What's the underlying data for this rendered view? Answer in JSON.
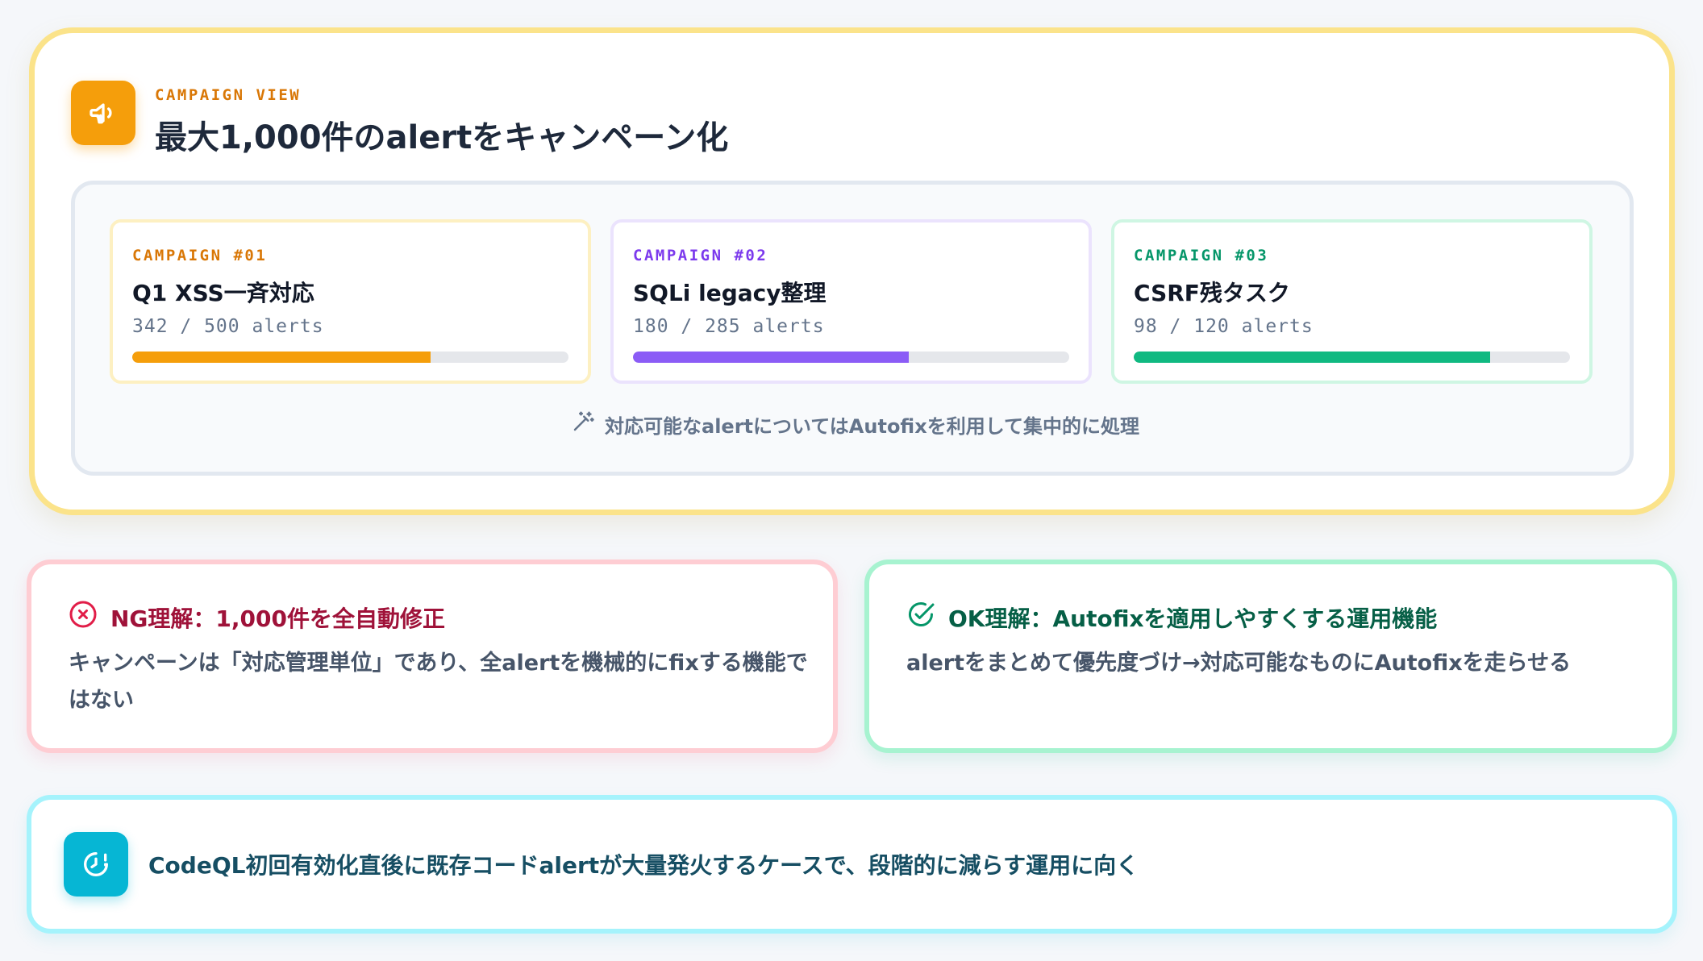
{
  "header": {
    "eyebrow": "CAMPAIGN VIEW",
    "title": "最大1,000件のalertをキャンペーン化",
    "icon": "megaphone-icon"
  },
  "campaigns": [
    {
      "tag": "CAMPAIGN #01",
      "name": "Q1 XSS一斉対応",
      "count": "342 / 500 alerts",
      "progress": 0.684,
      "color": "#f59e0b"
    },
    {
      "tag": "CAMPAIGN #02",
      "name": "SQLi legacy整理",
      "count": "180 / 285 alerts",
      "progress": 0.632,
      "color": "#8b5cf6"
    },
    {
      "tag": "CAMPAIGN #03",
      "name": "CSRF残タスク",
      "count": "98 / 120 alerts",
      "progress": 0.817,
      "color": "#10b981"
    }
  ],
  "autofix_note": {
    "icon": "magic-wand-icon",
    "text": "対応可能なalertについてはAutofixを利用して集中的に処理"
  },
  "ng": {
    "icon": "x-circle-icon",
    "title": "NG理解：1,000件を全自動修正",
    "body": "キャンペーンは「対応管理単位」であり、全alertを機械的にfixする機能ではない"
  },
  "ok": {
    "icon": "check-circle-icon",
    "title": "OK理解：Autofixを適用しやすくする運用機能",
    "body": "alertをまとめて優先度づけ→対応可能なものにAutofixを走らせる"
  },
  "info": {
    "icon": "clock-alert-icon",
    "text": "CodeQL初回有効化直後に既存コードalertが大量発火するケースで、段階的に減らす運用に向く"
  }
}
